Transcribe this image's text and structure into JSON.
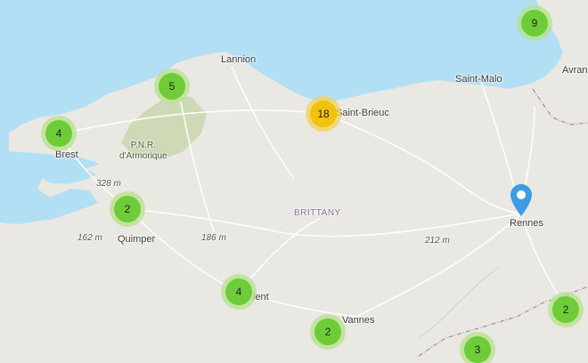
{
  "map": {
    "region_label": "BRITTANY",
    "park_label": "P.N.R.\nd'Armorique",
    "cities": {
      "lannion": "Lannion",
      "saint_malo": "Saint-Malo",
      "saint_brieuc": "Saint-Brieuc",
      "brest": "Brest",
      "quimper": "Quimper",
      "rennes": "Rennes",
      "vannes": "Vannes",
      "lorient_partial": "ient",
      "avranches_partial": "Avran"
    },
    "elevations": {
      "e328": "328 m",
      "e162": "162 m",
      "e186": "186 m",
      "e212": "212 m"
    },
    "clusters": {
      "top_right": "9",
      "lannion_west": "5",
      "brest": "4",
      "saint_brieuc": "18",
      "quimper": "2",
      "lorient": "4",
      "vannes": "2",
      "bottom_right": "2",
      "bottom": "3"
    },
    "colors": {
      "sea": "#b3dff4",
      "land": "#eae8e2",
      "park": "#c9d7ad",
      "cluster_small": "#6ecc39",
      "cluster_medium": "#f0c20c",
      "marker": "#3d9ce3",
      "boundary": "#a58aa8"
    },
    "marker_icon": "map-pin-icon"
  }
}
